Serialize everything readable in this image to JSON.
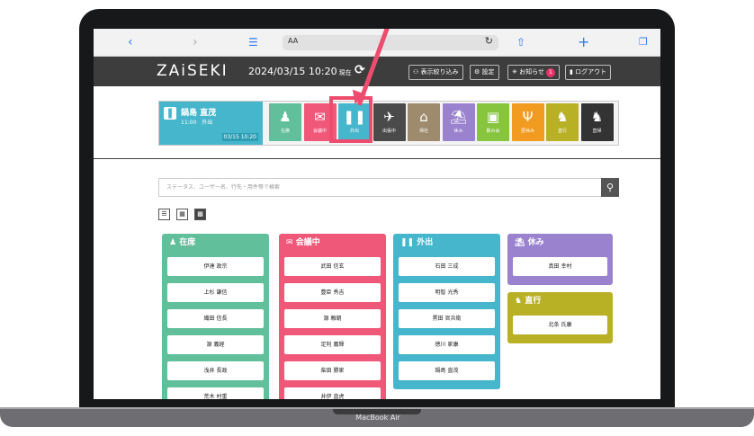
{
  "safari": {
    "back_icon": "chevron-left-icon",
    "forward_icon": "chevron-right-icon",
    "url_aa": "AA"
  },
  "header": {
    "logo": "ZAiSEKI",
    "datetime": "2024/03/15 10:20",
    "datetime_suffix": "現在",
    "filter_label": "表示絞り込み",
    "settings_label": "設定",
    "notice_label": "お知らせ",
    "notice_count": "1",
    "logout_label": "ログアウト"
  },
  "user_card": {
    "name": "鍋島 直茂",
    "status": "11:00　外出",
    "timestamp": "03/15 10:20"
  },
  "status_buttons": [
    {
      "label": "在席",
      "glyph": "♟",
      "color": "#62bf9c"
    },
    {
      "label": "会議中",
      "glyph": "✉",
      "color": "#f0587a"
    },
    {
      "label": "外出",
      "glyph": "❚❚",
      "color": "#46b6cc"
    },
    {
      "label": "出張中",
      "glyph": "✈",
      "color": "#4a4a4a"
    },
    {
      "label": "帰社",
      "glyph": "⌂",
      "color": "#9e8b6d"
    },
    {
      "label": "休み",
      "glyph": "⛱",
      "color": "#9a82cf"
    },
    {
      "label": "飲み会",
      "glyph": "▣",
      "color": "#86c53d"
    },
    {
      "label": "昼休み",
      "glyph": "Ψ",
      "color": "#f29b21"
    },
    {
      "label": "直行",
      "glyph": "♞",
      "color": "#b8b025"
    },
    {
      "label": "直帰",
      "glyph": "♞",
      "color": "#333333"
    }
  ],
  "search": {
    "placeholder": "ステータス、ユーザー名、行先・用件等で検索"
  },
  "columns": [
    {
      "title": "在席",
      "color": "#62bf9c",
      "members": [
        "伊達 政宗",
        "上杉 謙信",
        "織田 信長",
        "源 義経",
        "浅井 長政",
        "荒木 村重"
      ]
    },
    {
      "title": "会議中",
      "color": "#f0587a",
      "members": [
        "武田 信玄",
        "豊臣 秀吉",
        "源 頼朝",
        "足利 義輝",
        "柴田 勝家",
        "井伊 直虎"
      ]
    },
    {
      "title": "外出",
      "color": "#46b6cc",
      "members": [
        "石田 三成",
        "明智 光秀",
        "黒田 官兵衛",
        "徳川 家康",
        "鍋島 直茂"
      ]
    },
    {
      "title": "休み",
      "color": "#9a82cf",
      "members": [
        "真田 幸村"
      ]
    },
    {
      "title": "直行",
      "color": "#b8b025",
      "members": [
        "北条 氏康"
      ]
    }
  ],
  "device_label": "MacBook Air"
}
